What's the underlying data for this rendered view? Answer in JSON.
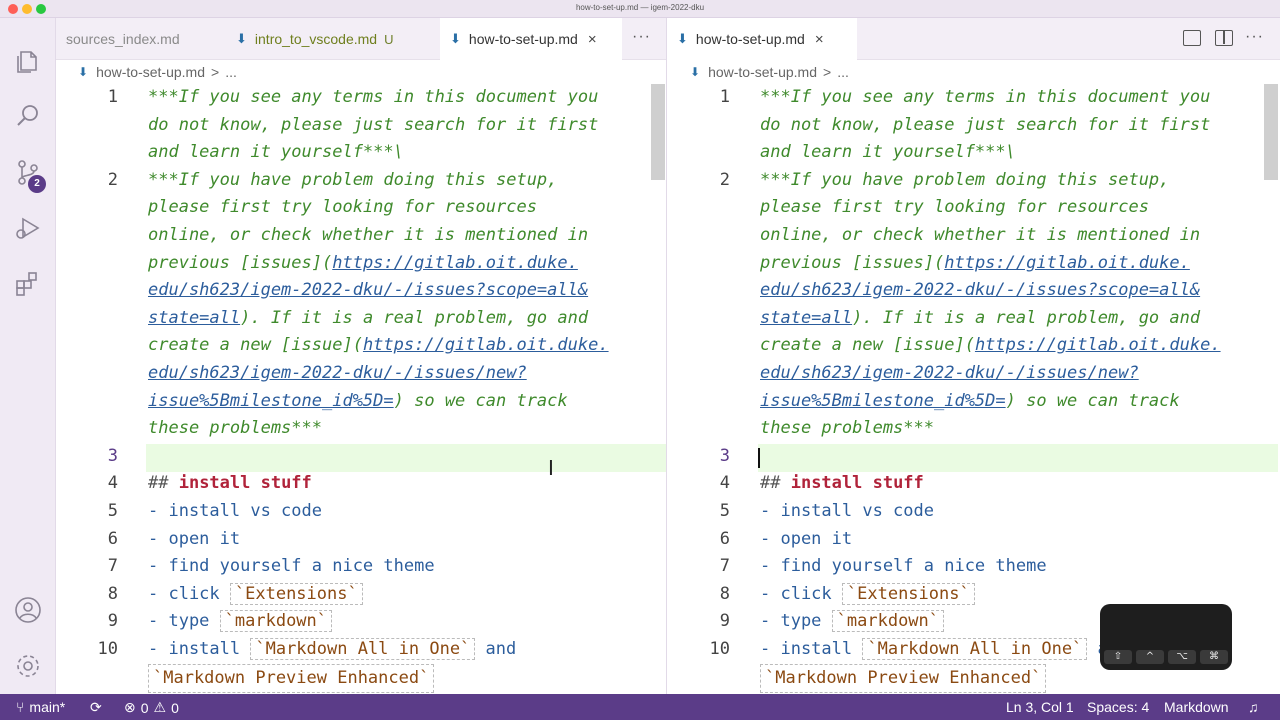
{
  "window": {
    "title": "how-to-set-up.md — igem-2022-dku"
  },
  "tabs_left": [
    {
      "label": "sources_index.md"
    },
    {
      "label": "intro_to_vscode.md",
      "status": "U"
    },
    {
      "label": "how-to-set-up.md",
      "close": "×"
    }
  ],
  "tabs_right": [
    {
      "label": "how-to-set-up.md",
      "close": "×"
    }
  ],
  "more_label": "···",
  "breadcrumb": {
    "file": "how-to-set-up.md",
    "separator": ">",
    "rest": "..."
  },
  "scm_badge": "2",
  "editor": {
    "line_numbers": [
      "1",
      "2",
      "3",
      "4",
      "5",
      "6",
      "7",
      "8",
      "9",
      "10"
    ],
    "l1a": "***If you see any terms in this document you",
    "l1b": "do not know, please just search for it first",
    "l1c": "and learn it yourself***\\",
    "l2a": "***If you have problem doing this setup,",
    "l2b": "please first try looking for resources",
    "l2c": "online, or check whether it is mentioned in",
    "l2d_pre": "previous [issues](",
    "l2d_link": "https://gitlab.oit.duke.",
    "l2e_link": "edu/sh623/igem-2022-dku/-/issues?scope=all&",
    "l2f_link": "state=all",
    "l2f_post": "). If it is a real problem, go and",
    "l2g_pre": "create a new [issue](",
    "l2g_link": "https://gitlab.oit.duke.",
    "l2h_link": "edu/sh623/igem-2022-dku/-/issues/new?",
    "l2i_link": "issue%5Bmilestone_id%5D=",
    "l2i_post": ") so we can track",
    "l2j": "these problems***",
    "l4_hash": "## ",
    "l4_text": "install stuff",
    "l5": "- install vs code",
    "l6": "- open it",
    "l7": "- find yourself a nice theme",
    "l8_pre": "- click ",
    "l8_code": "`Extensions`",
    "l9_pre": "- type ",
    "l9_code": "`markdown`",
    "l10_pre": "- install ",
    "l10_code": "`Markdown All in One`",
    "l10_post": " and",
    "l10b_code": "`Markdown Preview Enhanced`"
  },
  "status": {
    "branch": "main*",
    "errors": "0",
    "warnings": "0",
    "position": "Ln 3, Col 1",
    "spaces": "Spaces: 4",
    "language": "Markdown"
  },
  "keys_overlay": [
    "⇧",
    "^",
    "⌥",
    "⌘"
  ],
  "colors": {
    "accent": "#5b3c88",
    "italic_green": "#3f8a2c",
    "link": "#2c5d9c",
    "heading": "#b0233a"
  }
}
